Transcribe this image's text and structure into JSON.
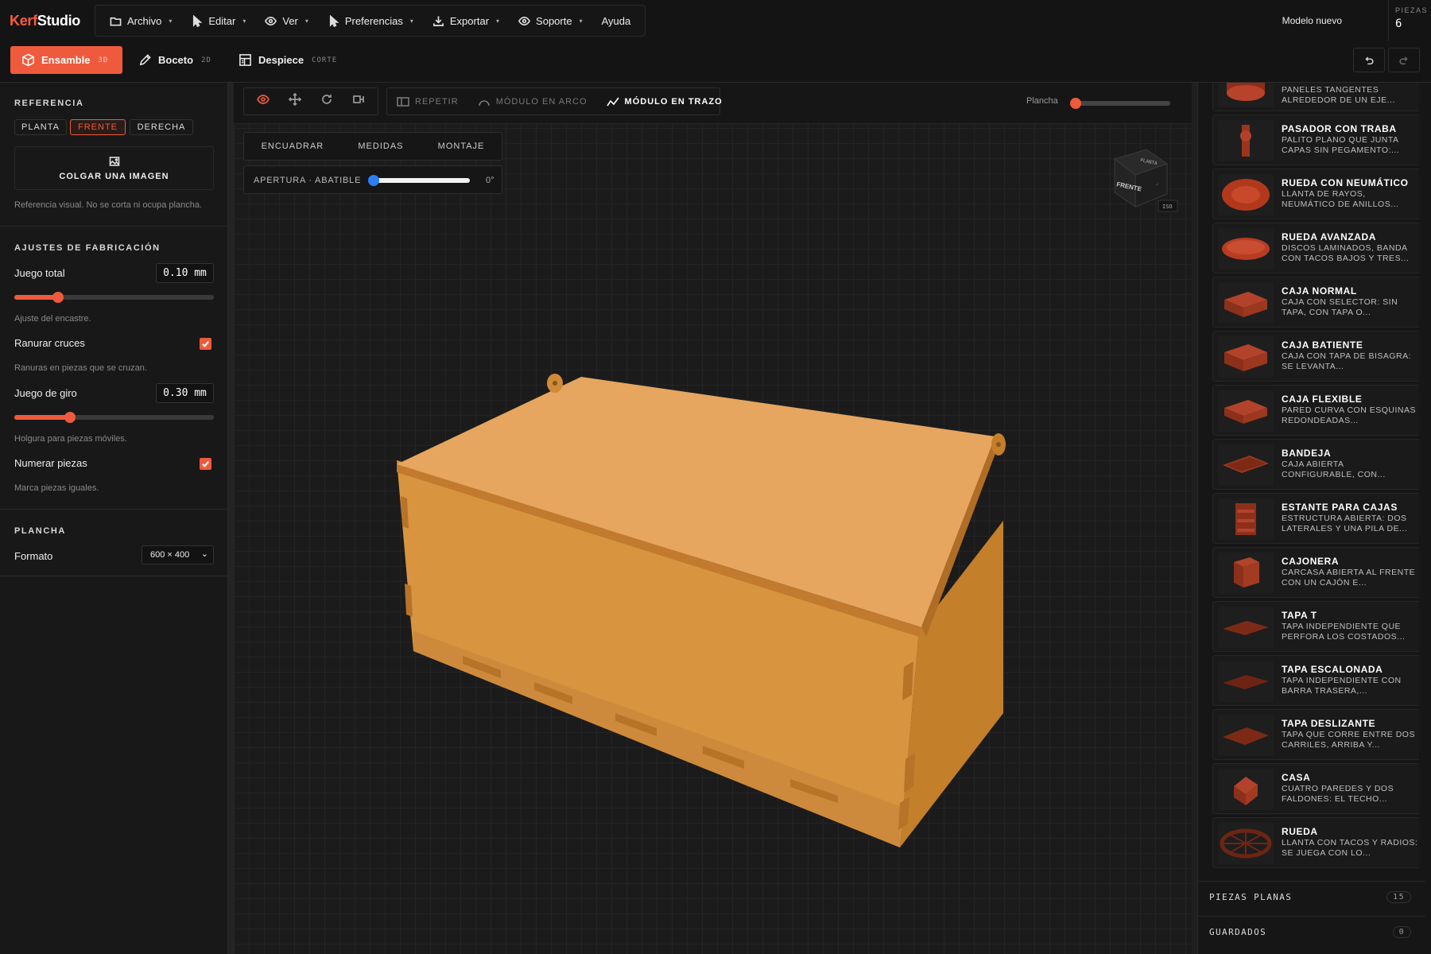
{
  "app": {
    "logo_a": "Kerf",
    "logo_b": "Studio",
    "model_name": "Modelo nuevo",
    "pieces_label": "PIEZAS",
    "pieces_count": "6"
  },
  "menu": {
    "archivo": "Archivo",
    "editar": "Editar",
    "ver": "Ver",
    "preferencias": "Preferencias",
    "exportar": "Exportar",
    "soporte": "Soporte",
    "ayuda": "Ayuda"
  },
  "modes": {
    "ensamble": "Ensamble",
    "ensamble_sub": "3D",
    "boceto": "Boceto",
    "boceto_sub": "2D",
    "despiece": "Despiece",
    "despiece_sub": "CORTE"
  },
  "left": {
    "referencia_title": "REFERENCIA",
    "view_planta": "PLANTA",
    "view_frente": "FRENTE",
    "view_derecha": "DERECHA",
    "colgar_imagen": "COLGAR UNA IMAGEN",
    "referencia_note": "Referencia visual. No se corta ni ocupa plancha.",
    "ajustes_title": "AJUSTES DE FABRICACIÓN",
    "juego_total_label": "Juego total",
    "juego_total_value": "0.10 mm",
    "juego_total_fraction": 0.22,
    "juego_total_note": "Ajuste del encastre.",
    "ranurar_label": "Ranurar cruces",
    "ranurar_checked": true,
    "ranurar_note": "Ranuras en piezas que se cruzan.",
    "juego_giro_label": "Juego de giro",
    "juego_giro_value": "0.30 mm",
    "juego_giro_fraction": 0.28,
    "juego_giro_note": "Holgura para piezas móviles.",
    "numerar_label": "Numerar piezas",
    "numerar_checked": true,
    "numerar_note": "Marca piezas iguales.",
    "plancha_title": "PLANCHA",
    "formato_label": "Formato",
    "formato_value": "600 × 400"
  },
  "canvas": {
    "repetir": "REPETIR",
    "modulo_arco": "MÓDULO EN ARCO",
    "modulo_trazo": "MÓDULO EN TRAZO",
    "plancha_label": "Plancha",
    "encuadrar": "ENCUADRAR",
    "medidas": "MEDIDAS",
    "montaje": "MONTAJE",
    "apertura_label": "APERTURA · ABATIBLE",
    "apertura_value": "0°",
    "cube_front": "FRENTE",
    "cube_top": "PLANTA",
    "cube_iso": "ISO"
  },
  "catalog": [
    {
      "title": "",
      "desc": "PANELES TANGENTES ALREDEDOR DE UN EJE...",
      "icon": "cylinder-icon"
    },
    {
      "title": "PASADOR CON TRABA",
      "desc": "PALITO PLANO QUE JUNTA CAPAS SIN PEGAMENTO:...",
      "icon": "pin-icon"
    },
    {
      "title": "RUEDA CON NEUMÁTICO",
      "desc": "LLANTA DE RAYOS, NEUMÁTICO DE ANILLOS...",
      "icon": "tire-icon"
    },
    {
      "title": "RUEDA AVANZADA",
      "desc": "DISCOS LAMINADOS, BANDA CON TACOS BAJOS Y TRES...",
      "icon": "disc-icon"
    },
    {
      "title": "CAJA NORMAL",
      "desc": "CAJA CON SELECTOR: SIN TAPA, CON TAPA O...",
      "icon": "box-icon"
    },
    {
      "title": "CAJA BATIENTE",
      "desc": "CAJA CON TAPA DE BISAGRA: SE LEVANTA...",
      "icon": "hinge-box-icon"
    },
    {
      "title": "CAJA FLEXIBLE",
      "desc": "PARED CURVA CON ESQUINAS REDONDEADAS...",
      "icon": "flex-box-icon"
    },
    {
      "title": "BANDEJA",
      "desc": "CAJA ABIERTA CONFIGURABLE, CON...",
      "icon": "tray-icon"
    },
    {
      "title": "ESTANTE PARA CAJAS",
      "desc": "ESTRUCTURA ABIERTA: DOS LATERALES Y UNA PILA DE...",
      "icon": "shelf-icon"
    },
    {
      "title": "CAJONERA",
      "desc": "CARCASA ABIERTA AL FRENTE CON UN CAJÓN E...",
      "icon": "drawer-icon"
    },
    {
      "title": "TAPA T",
      "desc": "TAPA INDEPENDIENTE QUE PERFORA LOS COSTADOS...",
      "icon": "lid-icon"
    },
    {
      "title": "TAPA ESCALONADA",
      "desc": "TAPA INDEPENDIENTE CON BARRA TRASERA,...",
      "icon": "lid-step-icon"
    },
    {
      "title": "TAPA DESLIZANTE",
      "desc": "TAPA QUE CORRE ENTRE DOS CARRILES, ARRIBA Y...",
      "icon": "lid-slide-icon"
    },
    {
      "title": "CASA",
      "desc": "CUATRO PAREDES Y DOS FALDONES: EL TECHO...",
      "icon": "house-icon"
    },
    {
      "title": "RUEDA",
      "desc": "LLANTA CON TACOS Y RADIOS: SE JUEGA CON LO...",
      "icon": "wheel-icon"
    }
  ],
  "footer": {
    "piezas_planas": "PIEZAS PLANAS",
    "piezas_planas_count": "15",
    "guardados": "GUARDADOS",
    "guardados_count": "0"
  },
  "colors": {
    "accent": "#ef5a3c",
    "wood_top": "#e6a65f",
    "wood_front": "#d8943f",
    "wood_side": "#c47f2a",
    "thumb": "#a8381f"
  }
}
